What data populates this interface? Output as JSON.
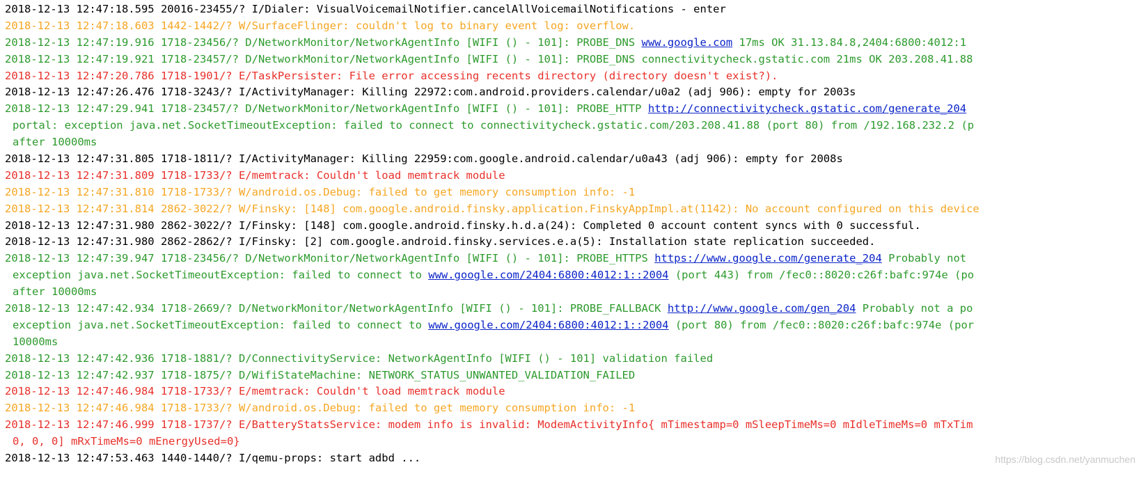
{
  "colors": {
    "I": "#000000",
    "D": "#2d9a2d",
    "W": "#f5a623",
    "E": "#e8302a",
    "link": "#0b24c8"
  },
  "lines": [
    {
      "level": "I",
      "segments": [
        {
          "t": "2018-12-13 12:47:18.595 20016-23455/? I/Dialer: VisualVoicemailNotifier.cancelAllVoicemailNotifications - enter"
        }
      ]
    },
    {
      "level": "W",
      "segments": [
        {
          "t": "2018-12-13 12:47:18.603 1442-1442/? W/SurfaceFlinger: couldn't log to binary event log: overflow."
        }
      ]
    },
    {
      "level": "D",
      "segments": [
        {
          "t": "2018-12-13 12:47:19.916 1718-23456/? D/NetworkMonitor/NetworkAgentInfo [WIFI () - 101]: PROBE_DNS "
        },
        {
          "t": "www.google.com",
          "link": true
        },
        {
          "t": " 17ms OK 31.13.84.8,2404:6800:4012:1"
        }
      ]
    },
    {
      "level": "D",
      "segments": [
        {
          "t": "2018-12-13 12:47:19.921 1718-23457/? D/NetworkMonitor/NetworkAgentInfo [WIFI () - 101]: PROBE_DNS connectivitycheck.gstatic.com 21ms OK 203.208.41.88"
        }
      ]
    },
    {
      "level": "E",
      "segments": [
        {
          "t": "2018-12-13 12:47:20.786 1718-1901/? E/TaskPersister: File error accessing recents directory (directory doesn't exist?)."
        }
      ]
    },
    {
      "level": "I",
      "segments": [
        {
          "t": "2018-12-13 12:47:26.476 1718-3243/? I/ActivityManager: Killing 22972:com.android.providers.calendar/u0a2 (adj 906): empty for 2003s"
        }
      ]
    },
    {
      "level": "D",
      "segments": [
        {
          "t": "2018-12-13 12:47:29.941 1718-23457/? D/NetworkMonitor/NetworkAgentInfo [WIFI () - 101]: PROBE_HTTP "
        },
        {
          "t": "http://connectivitycheck.gstatic.com/generate_204",
          "link": true
        }
      ]
    },
    {
      "level": "D",
      "cont": true,
      "segments": [
        {
          "t": "portal: exception java.net.SocketTimeoutException: failed to connect to connectivitycheck.gstatic.com/203.208.41.88 (port 80) from /192.168.232.2 (p"
        }
      ]
    },
    {
      "level": "D",
      "cont": true,
      "segments": [
        {
          "t": "after 10000ms"
        }
      ]
    },
    {
      "level": "I",
      "segments": [
        {
          "t": "2018-12-13 12:47:31.805 1718-1811/? I/ActivityManager: Killing 22959:com.google.android.calendar/u0a43 (adj 906): empty for 2008s"
        }
      ]
    },
    {
      "level": "E",
      "segments": [
        {
          "t": "2018-12-13 12:47:31.809 1718-1733/? E/memtrack: Couldn't load memtrack module"
        }
      ]
    },
    {
      "level": "W",
      "segments": [
        {
          "t": "2018-12-13 12:47:31.810 1718-1733/? W/android.os.Debug: failed to get memory consumption info: -1"
        }
      ]
    },
    {
      "level": "W",
      "segments": [
        {
          "t": "2018-12-13 12:47:31.814 2862-3022/? W/Finsky: [148] com.google.android.finsky.application.FinskyAppImpl.at(1142): No account configured on this device"
        }
      ]
    },
    {
      "level": "I",
      "segments": [
        {
          "t": "2018-12-13 12:47:31.980 2862-3022/? I/Finsky: [148] com.google.android.finsky.h.d.a(24): Completed 0 account content syncs with 0 successful."
        }
      ]
    },
    {
      "level": "I",
      "segments": [
        {
          "t": "2018-12-13 12:47:31.980 2862-2862/? I/Finsky: [2] com.google.android.finsky.services.e.a(5): Installation state replication succeeded."
        }
      ]
    },
    {
      "level": "D",
      "segments": [
        {
          "t": "2018-12-13 12:47:39.947 1718-23456/? D/NetworkMonitor/NetworkAgentInfo [WIFI () - 101]: PROBE_HTTPS "
        },
        {
          "t": "https://www.google.com/generate_204",
          "link": true
        },
        {
          "t": " Probably not"
        }
      ]
    },
    {
      "level": "D",
      "cont": true,
      "segments": [
        {
          "t": "exception java.net.SocketTimeoutException: failed to connect to "
        },
        {
          "t": "www.google.com/2404:6800:4012:1::2004",
          "link": true
        },
        {
          "t": " (port 443) from /fec0::8020:c26f:bafc:974e (po"
        }
      ]
    },
    {
      "level": "D",
      "cont": true,
      "segments": [
        {
          "t": "after 10000ms"
        }
      ]
    },
    {
      "level": "D",
      "segments": [
        {
          "t": "2018-12-13 12:47:42.934 1718-2669/? D/NetworkMonitor/NetworkAgentInfo [WIFI () - 101]: PROBE_FALLBACK "
        },
        {
          "t": "http://www.google.com/gen_204",
          "link": true
        },
        {
          "t": " Probably not a po"
        }
      ]
    },
    {
      "level": "D",
      "cont": true,
      "segments": [
        {
          "t": "exception java.net.SocketTimeoutException: failed to connect to "
        },
        {
          "t": "www.google.com/2404:6800:4012:1::2004",
          "link": true
        },
        {
          "t": " (port 80) from /fec0::8020:c26f:bafc:974e (por"
        }
      ]
    },
    {
      "level": "D",
      "cont": true,
      "segments": [
        {
          "t": "10000ms"
        }
      ]
    },
    {
      "level": "D",
      "segments": [
        {
          "t": "2018-12-13 12:47:42.936 1718-1881/? D/ConnectivityService: NetworkAgentInfo [WIFI () - 101] validation failed"
        }
      ]
    },
    {
      "level": "D",
      "segments": [
        {
          "t": "2018-12-13 12:47:42.937 1718-1875/? D/WifiStateMachine: NETWORK_STATUS_UNWANTED_VALIDATION_FAILED"
        }
      ]
    },
    {
      "level": "E",
      "segments": [
        {
          "t": "2018-12-13 12:47:46.984 1718-1733/? E/memtrack: Couldn't load memtrack module"
        }
      ]
    },
    {
      "level": "W",
      "segments": [
        {
          "t": "2018-12-13 12:47:46.984 1718-1733/? W/android.os.Debug: failed to get memory consumption info: -1"
        }
      ]
    },
    {
      "level": "E",
      "segments": [
        {
          "t": "2018-12-13 12:47:46.999 1718-1737/? E/BatteryStatsService: modem info is invalid: ModemActivityInfo{ mTimestamp=0 mSleepTimeMs=0 mIdleTimeMs=0 mTxTim"
        }
      ]
    },
    {
      "level": "E",
      "cont": true,
      "segments": [
        {
          "t": "0, 0, 0] mRxTimeMs=0 mEnergyUsed=0}"
        }
      ]
    },
    {
      "level": "I",
      "segments": [
        {
          "t": "2018-12-13 12:47:53.463 1440-1440/? I/qemu-props: start adbd ..."
        }
      ]
    }
  ],
  "watermark": "https://blog.csdn.net/yanmuchen"
}
